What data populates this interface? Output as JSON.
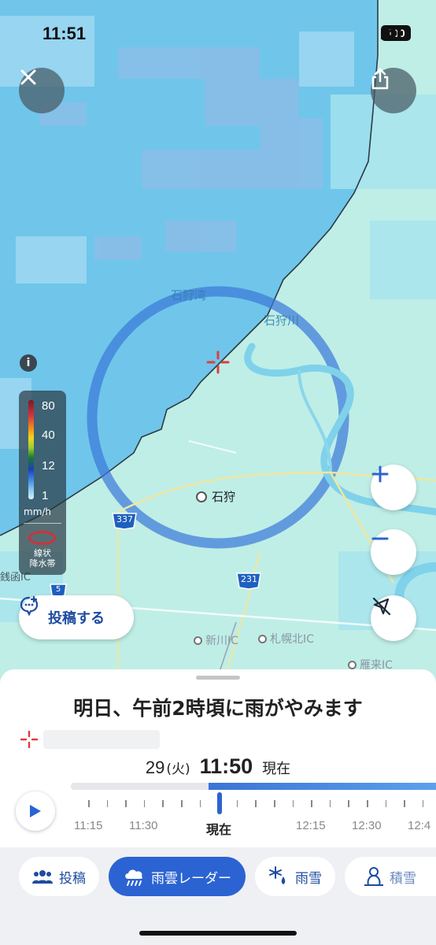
{
  "status_bar": {
    "time": "11:51",
    "battery": "100"
  },
  "map": {
    "labels": {
      "ishikari_bay": "石狩湾",
      "ishikari_river": "石狩川",
      "ishikari_city": "石狩",
      "route_337": "337",
      "route_231": "231",
      "route_5": "5",
      "shinkawa_ic": "新川IC",
      "sapporo_kita_ic": "札幌北IC",
      "karikiCorner_ic": "雁来IC",
      "zenigata_ic": "銭函IC"
    },
    "legend": {
      "values": [
        "80",
        "40",
        "12",
        "1"
      ],
      "unit": "mm/h",
      "note_line1": "線状",
      "note_line2": "降水帯",
      "info_icon": "i"
    },
    "post_button": "投稿する"
  },
  "sheet": {
    "headline": "明日、午前2時頃に雨がやみます",
    "date": "29",
    "day_of_week": "(火)",
    "clock": "11:50",
    "now_label": "現在",
    "progress": 0.45,
    "timeline_labels": [
      "11:15",
      "11:30",
      "現在",
      "12:15",
      "12:30",
      "12:4"
    ]
  },
  "tabs": [
    {
      "label": "投稿",
      "icon": "people-icon",
      "active": false
    },
    {
      "label": "雨雲レーダー",
      "icon": "rain-cloud-icon",
      "active": true
    },
    {
      "label": "雨雪",
      "icon": "snow-rain-icon",
      "active": false
    },
    {
      "label": "積雪",
      "icon": "snowman-icon",
      "active": false
    }
  ],
  "colors": {
    "accent": "#2b63d3",
    "sea": "#6fc6ea",
    "land": "#bfeee6",
    "rain_light": "#8fd3f2",
    "rain_moderate": "#4e8ee0",
    "marker": "#e03c3c"
  }
}
